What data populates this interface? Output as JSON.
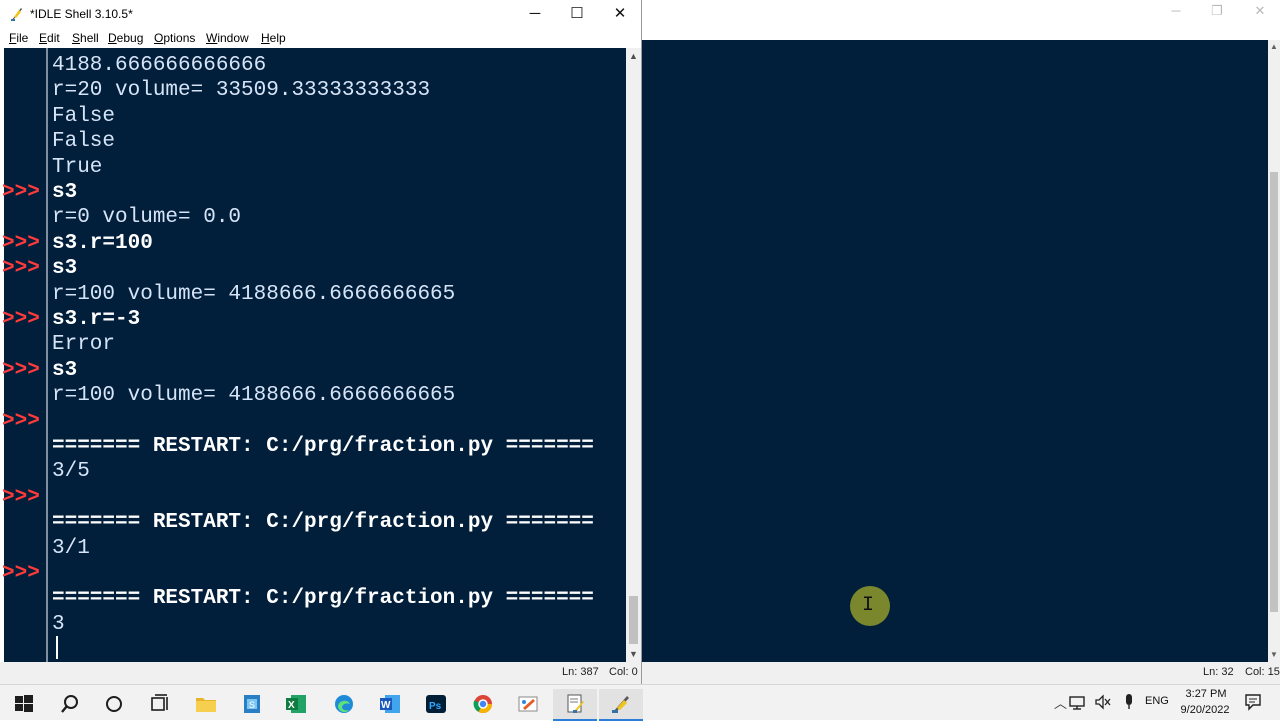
{
  "window": {
    "title": "*IDLE Shell 3.10.5*",
    "minimize_glyph": "─",
    "maximize_glyph": "☐",
    "close_glyph": "✕"
  },
  "menu": [
    {
      "label": "File",
      "key": "F",
      "rest": "ile"
    },
    {
      "label": "Edit",
      "key": "E",
      "rest": "dit"
    },
    {
      "label": "Shell",
      "key": "S",
      "rest": "hell"
    },
    {
      "label": "Debug",
      "key": "D",
      "rest": "ebug"
    },
    {
      "label": "Options",
      "key": "O",
      "rest": "ptions"
    },
    {
      "label": "Window",
      "key": "W",
      "rest": "indow"
    },
    {
      "label": "Help",
      "key": "H",
      "rest": "elp"
    }
  ],
  "shell": {
    "prompt": ">>>",
    "lines": [
      {
        "text": "4188.666666666666",
        "kind": "output"
      },
      {
        "text": "r=20 volume= 33509.33333333333",
        "kind": "output"
      },
      {
        "text": "False",
        "kind": "output"
      },
      {
        "text": "False",
        "kind": "output"
      },
      {
        "text": "True",
        "kind": "output"
      },
      {
        "text": "s3",
        "kind": "input"
      },
      {
        "text": "r=0 volume= 0.0",
        "kind": "output"
      },
      {
        "text": "s3.r=100",
        "kind": "input"
      },
      {
        "text": "s3",
        "kind": "input"
      },
      {
        "text": "r=100 volume= 4188666.6666666665",
        "kind": "output"
      },
      {
        "text": "s3.r=-3",
        "kind": "input"
      },
      {
        "text": "Error",
        "kind": "output"
      },
      {
        "text": "s3",
        "kind": "input"
      },
      {
        "text": "r=100 volume= 4188666.6666666665",
        "kind": "output"
      },
      {
        "text": "",
        "kind": "input"
      },
      {
        "text": "======= RESTART: C:/prg/fraction.py =======",
        "kind": "restart"
      },
      {
        "text": "3/5",
        "kind": "output"
      },
      {
        "text": "",
        "kind": "input"
      },
      {
        "text": "======= RESTART: C:/prg/fraction.py =======",
        "kind": "restart"
      },
      {
        "text": "3/1",
        "kind": "output"
      },
      {
        "text": "",
        "kind": "input"
      },
      {
        "text": "======= RESTART: C:/prg/fraction.py =======",
        "kind": "restart"
      },
      {
        "text": "3",
        "kind": "output"
      }
    ]
  },
  "status": {
    "line": "Ln: 387",
    "col": "Col: 0"
  },
  "background_window": {
    "status_line": "Ln: 32",
    "status_col": "Col: 15",
    "background_color": "#011e3a"
  },
  "taskbar": {
    "icons": [
      "windows-start-icon",
      "search-icon",
      "cortana-icon",
      "task-view-icon",
      "file-explorer-icon",
      "sandbox-icon",
      "excel-icon",
      "edge-icon",
      "word-icon",
      "photoshop-icon",
      "chrome-icon",
      "paint-icon",
      "idle-editor-icon",
      "python-idle-icon"
    ],
    "language": "ENG",
    "time": "3:27 PM",
    "date": "9/20/2022"
  },
  "colors": {
    "shell_bg": "#011e3a",
    "prompt": "#ff3b3b",
    "accent": "#2b7fd9"
  }
}
